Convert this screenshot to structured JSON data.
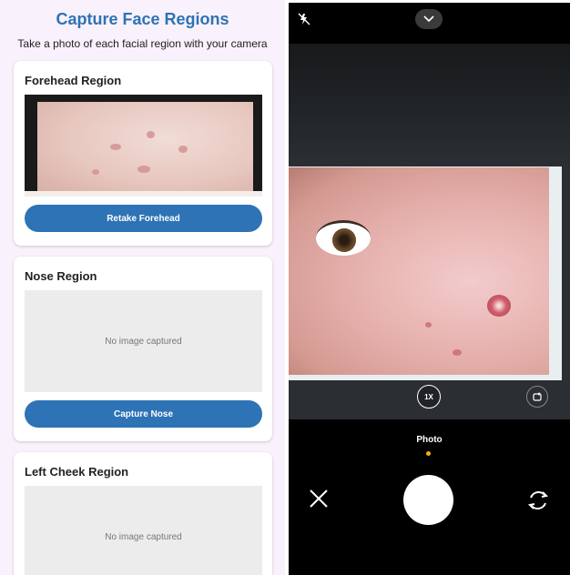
{
  "app": {
    "title": "Capture Face Regions",
    "subtitle": "Take a photo of each facial region with your camera",
    "regions": [
      {
        "title": "Forehead Region",
        "button_label": "Retake Forehead",
        "placeholder": ""
      },
      {
        "title": "Nose Region",
        "button_label": "Capture Nose",
        "placeholder": "No image captured"
      },
      {
        "title": "Left Cheek Region",
        "button_label": "",
        "placeholder": "No image captured"
      }
    ],
    "colors": {
      "accent": "#2d73b5",
      "background": "#f9f1fb"
    }
  },
  "camera": {
    "zoom_label": "1X",
    "mode_label": "Photo",
    "icons": [
      "flash-off-icon",
      "chevron-down-icon",
      "sticker-icon",
      "close-icon",
      "shutter-button",
      "flip-camera-icon"
    ],
    "colors": {
      "mode_indicator": "#f5b400"
    }
  }
}
